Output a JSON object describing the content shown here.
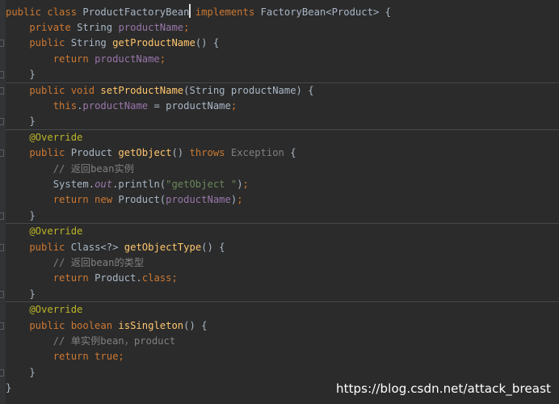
{
  "editor": {
    "language": "java",
    "lines": [
      [
        {
          "t": "public class ",
          "c": "kw"
        },
        {
          "t": "ProductFactoryBean",
          "c": "plain"
        },
        {
          "t": " implements ",
          "c": "kw"
        },
        {
          "t": "FactoryBean<Product> {",
          "c": "plain"
        }
      ],
      [
        {
          "t": "    private ",
          "c": "kw"
        },
        {
          "t": "String ",
          "c": "plain"
        },
        {
          "t": "productName",
          "c": "fld"
        },
        {
          "t": ";",
          "c": "kw"
        }
      ],
      [
        {
          "t": "    public ",
          "c": "kw"
        },
        {
          "t": "String ",
          "c": "plain"
        },
        {
          "t": "getProductName",
          "c": "fn"
        },
        {
          "t": "() {",
          "c": "plain"
        }
      ],
      [
        {
          "t": "        return ",
          "c": "kw"
        },
        {
          "t": "productName",
          "c": "fld"
        },
        {
          "t": ";",
          "c": "kw"
        }
      ],
      [
        {
          "t": "    }",
          "c": "plain"
        }
      ],
      [
        {
          "t": "    public void ",
          "c": "kw"
        },
        {
          "t": "setProductName",
          "c": "fn"
        },
        {
          "t": "(String productName) {",
          "c": "plain"
        }
      ],
      [
        {
          "t": "        this",
          "c": "kw"
        },
        {
          "t": ".",
          "c": "plain"
        },
        {
          "t": "productName",
          "c": "fld"
        },
        {
          "t": " = productName",
          "c": "plain"
        },
        {
          "t": ";",
          "c": "kw"
        }
      ],
      [
        {
          "t": "    }",
          "c": "plain"
        }
      ],
      [
        {
          "t": "    @Override",
          "c": "ann"
        }
      ],
      [
        {
          "t": "    public ",
          "c": "kw"
        },
        {
          "t": "Product ",
          "c": "plain"
        },
        {
          "t": "getObject",
          "c": "fn"
        },
        {
          "t": "() ",
          "c": "plain"
        },
        {
          "t": "throws ",
          "c": "kw"
        },
        {
          "t": "Exception",
          "c": "exc"
        },
        {
          "t": " {",
          "c": "plain"
        }
      ],
      [
        {
          "t": "        // ",
          "c": "cmt"
        },
        {
          "t": "返回",
          "c": "cmt cjk"
        },
        {
          "t": "bean",
          "c": "cmt"
        },
        {
          "t": "实例",
          "c": "cmt cjk"
        }
      ],
      [
        {
          "t": "        System.",
          "c": "plain"
        },
        {
          "t": "out",
          "c": "fld ital"
        },
        {
          "t": ".println(",
          "c": "plain"
        },
        {
          "t": "\"getObject \"",
          "c": "str"
        },
        {
          "t": ")",
          "c": "plain"
        },
        {
          "t": ";",
          "c": "kw"
        }
      ],
      [
        {
          "t": "        return new ",
          "c": "kw"
        },
        {
          "t": "Product(",
          "c": "plain"
        },
        {
          "t": "productName",
          "c": "fld"
        },
        {
          "t": ")",
          "c": "plain"
        },
        {
          "t": ";",
          "c": "kw"
        }
      ],
      [
        {
          "t": "    }",
          "c": "plain"
        }
      ],
      [
        {
          "t": "    @Override",
          "c": "ann"
        }
      ],
      [
        {
          "t": "    public ",
          "c": "kw"
        },
        {
          "t": "Class<?> ",
          "c": "plain"
        },
        {
          "t": "getObjectType",
          "c": "fn"
        },
        {
          "t": "() {",
          "c": "plain"
        }
      ],
      [
        {
          "t": "        // ",
          "c": "cmt"
        },
        {
          "t": "返回",
          "c": "cmt cjk"
        },
        {
          "t": "bean",
          "c": "cmt"
        },
        {
          "t": "的类型",
          "c": "cmt cjk"
        }
      ],
      [
        {
          "t": "        return ",
          "c": "kw"
        },
        {
          "t": "Product.",
          "c": "plain"
        },
        {
          "t": "class",
          "c": "kw"
        },
        {
          "t": ";",
          "c": "kw"
        }
      ],
      [
        {
          "t": "    }",
          "c": "plain"
        }
      ],
      [
        {
          "t": "    @Override",
          "c": "ann"
        }
      ],
      [
        {
          "t": "    public boolean ",
          "c": "kw"
        },
        {
          "t": "isSingleton",
          "c": "fn"
        },
        {
          "t": "() {",
          "c": "plain"
        }
      ],
      [
        {
          "t": "        // ",
          "c": "cmt"
        },
        {
          "t": "单实例",
          "c": "cmt cjk"
        },
        {
          "t": "bean",
          "c": "cmt"
        },
        {
          "t": "，",
          "c": "cmt cjk"
        },
        {
          "t": "product",
          "c": "cmt"
        }
      ],
      [
        {
          "t": "        return true",
          "c": "kw"
        },
        {
          "t": ";",
          "c": "kw"
        }
      ],
      [
        {
          "t": "    }",
          "c": "plain"
        }
      ],
      [
        {
          "t": "}",
          "c": "plain"
        }
      ]
    ]
  },
  "watermark": "https://blog.csdn.net/attack_breast",
  "colors": {
    "background": "#2b2b2b",
    "keyword": "#cc7832",
    "method": "#ffc66d",
    "field": "#9876aa",
    "string": "#6a8759",
    "comment": "#808080",
    "annotation": "#bbb529",
    "text": "#a9b7c6"
  }
}
